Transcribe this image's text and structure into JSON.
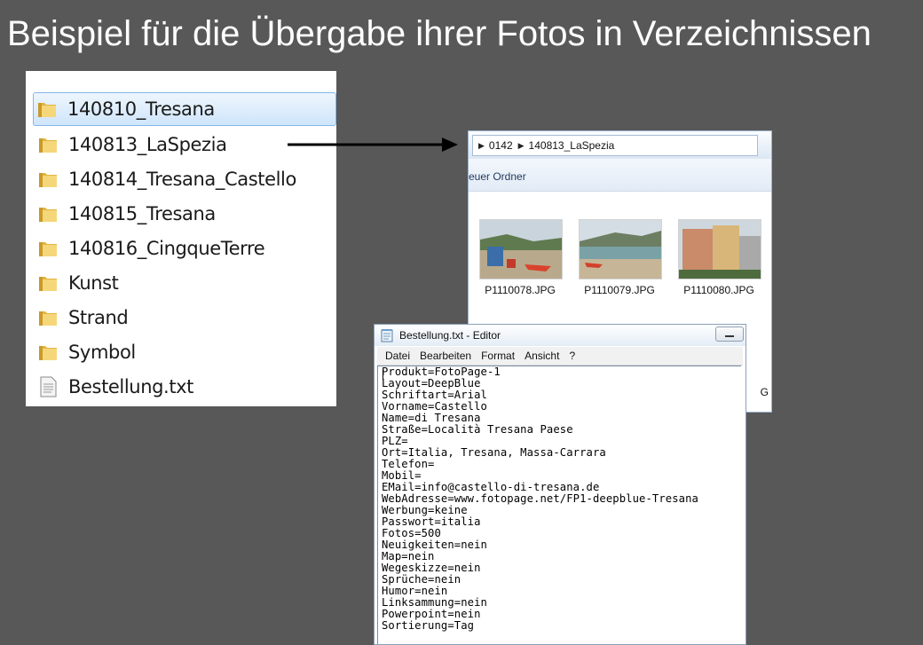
{
  "slide": {
    "title": "Beispiel für die Übergabe ihrer Fotos in Verzeichnissen"
  },
  "folder_list": {
    "items": [
      {
        "label": "140810_Tresana",
        "type": "folder",
        "selected": true
      },
      {
        "label": "140813_LaSpezia",
        "type": "folder",
        "selected": false
      },
      {
        "label": "140814_Tresana_Castello",
        "type": "folder",
        "selected": false
      },
      {
        "label": "140815_Tresana",
        "type": "folder",
        "selected": false
      },
      {
        "label": "140816_CingqueTerre",
        "type": "folder",
        "selected": false
      },
      {
        "label": "Kunst",
        "type": "folder",
        "selected": false
      },
      {
        "label": "Strand",
        "type": "folder",
        "selected": false
      },
      {
        "label": "Symbol",
        "type": "folder",
        "selected": false
      },
      {
        "label": "Bestellung.txt",
        "type": "file",
        "selected": false
      }
    ]
  },
  "explorer": {
    "breadcrumb": [
      "0142",
      "140813_LaSpezia"
    ],
    "toolbar_label": "euer Ordner",
    "thumbnails": [
      {
        "label": "P1110078.JPG"
      },
      {
        "label": "P1110079.JPG"
      },
      {
        "label": "P1110080.JPG"
      }
    ],
    "partial_label": "G"
  },
  "notepad": {
    "title": "Bestellung.txt - Editor",
    "menu": [
      "Datei",
      "Bearbeiten",
      "Format",
      "Ansicht",
      "?"
    ],
    "lines": [
      "Produkt=FotoPage-1",
      "Layout=DeepBlue",
      "Schriftart=Arial",
      "Vorname=Castello",
      "Name=di Tresana",
      "Straße=Località Tresana Paese",
      "PLZ=",
      "Ort=Italia, Tresana, Massa-Carrara",
      "Telefon=",
      "Mobil=",
      "EMail=info@castello-di-tresana.de",
      "WebAdresse=www.fotopage.net/FP1-deepblue-Tresana",
      "Werbung=keine",
      "Passwort=italia",
      "Fotos=500",
      "Neuigkeiten=nein",
      "Map=nein",
      "Wegeskizze=nein",
      "Sprüche=nein",
      "Humor=nein",
      "Linksammung=nein",
      "Powerpoint=nein",
      "Sortierung=Tag"
    ]
  },
  "icons": {
    "folder": "folder-icon",
    "text_file": "text-file-icon",
    "notepad": "notepad-icon",
    "arrow": "arrow-right-icon"
  },
  "colors": {
    "background": "#585858",
    "selection": "#cfe5fb",
    "folder_yellow": "#e8c04a"
  }
}
